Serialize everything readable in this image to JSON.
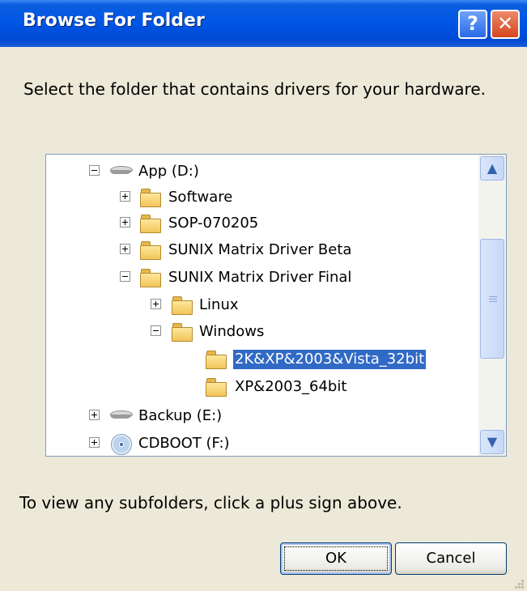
{
  "window": {
    "title": "Browse For Folder",
    "help_glyph": "?",
    "close_glyph": "✕",
    "colors": {
      "titlebar": "#0055e5",
      "selection": "#316ac5",
      "face": "#ece9d8"
    }
  },
  "instruction": "Select the folder that contains drivers for your hardware.",
  "tree": {
    "items": [
      {
        "label": "App (D:)",
        "icon": "hard-drive-icon",
        "expander": "collapse"
      },
      {
        "label": "Software",
        "icon": "folder-icon",
        "expander": "expand"
      },
      {
        "label": "SOP-070205",
        "icon": "folder-icon",
        "expander": "expand"
      },
      {
        "label": "SUNIX Matrix Driver Beta",
        "icon": "folder-icon",
        "expander": "expand"
      },
      {
        "label": "SUNIX Matrix Driver Final",
        "icon": "folder-icon",
        "expander": "collapse"
      },
      {
        "label": "Linux",
        "icon": "folder-icon",
        "expander": "expand"
      },
      {
        "label": "Windows",
        "icon": "folder-icon",
        "expander": "collapse"
      },
      {
        "label": "2K&XP&2003&Vista_32bit",
        "icon": "folder-icon",
        "selected": true
      },
      {
        "label": "XP&2003_64bit",
        "icon": "folder-icon"
      },
      {
        "label": "Backup (E:)",
        "icon": "hard-drive-icon",
        "expander": "expand"
      },
      {
        "label": "CDBOOT (F:)",
        "icon": "cd-drive-icon",
        "expander": "expand"
      }
    ],
    "scroll": {
      "up_glyph": "▲",
      "down_glyph": "▼"
    }
  },
  "hint": "To view any subfolders, click a plus sign above.",
  "buttons": {
    "ok": "OK",
    "cancel": "Cancel"
  }
}
